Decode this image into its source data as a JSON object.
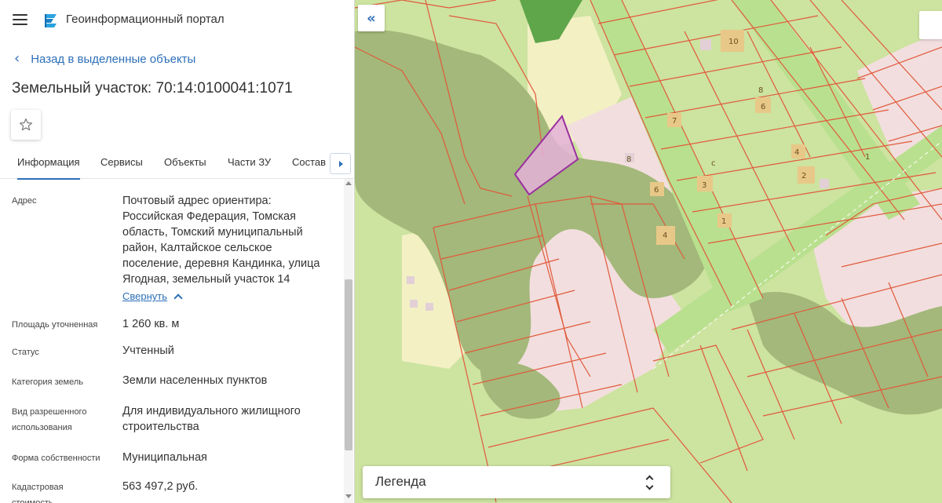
{
  "header": {
    "app_title": "Геоинформационный портал",
    "menu_icon": "hamburger-menu-icon",
    "logo_icon": "portal-logo-icon"
  },
  "navigation": {
    "back_label": "Назад в выделенные объекты"
  },
  "object": {
    "title": "Земельный участок: 70:14:0100041:1071"
  },
  "tabs": [
    {
      "label": "Информация",
      "active": true
    },
    {
      "label": "Сервисы",
      "active": false
    },
    {
      "label": "Объекты",
      "active": false
    },
    {
      "label": "Части ЗУ",
      "active": false
    },
    {
      "label": "Состав",
      "active": false
    }
  ],
  "info": {
    "address_label": "Адрес",
    "address_lines": [
      "Почтовый адрес ориентира:",
      "Российская Федерация, Томская",
      "область, Томский муниципальный",
      "район, Калтайское сельское",
      "поселение, деревня Кандинка, улица",
      "Ягодная, земельный участок 14"
    ],
    "collapse_label": "Свернуть",
    "area_label": "Площадь уточненная",
    "area_value": "1 260 кв. м",
    "status_label": "Статус",
    "status_value": "Учтенный",
    "category_label": "Категория земель",
    "category_value": "Земли населенных пунктов",
    "permitted_use_label_1": "Вид разрешенного",
    "permitted_use_label_2": "использования",
    "permitted_use_value_1": "Для индивидуального жилищного",
    "permitted_use_value_2": "строительства",
    "ownership_label": "Форма собственности",
    "ownership_value": "Муниципальная",
    "cadastral_value_label_1": "Кадастровая",
    "cadastral_value_label_2": "стоимость",
    "cadastral_value": "563 497,2 руб."
  },
  "map": {
    "legend_label": "Легенда",
    "plot_numbers": [
      "10",
      "8",
      "6",
      "7",
      "6",
      "4",
      "2",
      "3",
      "1",
      "4",
      "6",
      "8",
      "1",
      "c"
    ],
    "colors": {
      "background_green": "#cde3a0",
      "forest": "#a3b87a",
      "residential": "#f2dede",
      "road": "#b9e08e",
      "parcel_border": "#e05a3c",
      "selected_fill": "#e4b0d8",
      "selected_border": "#9a2fa0",
      "accent": "#2d6fb7"
    }
  }
}
